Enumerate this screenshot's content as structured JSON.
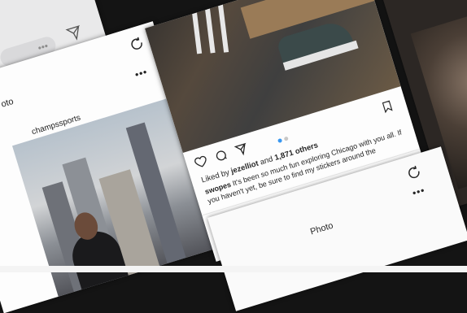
{
  "center_post": {
    "liked_prefix": "Liked by",
    "liked_user": "jezelliot",
    "liked_mid": "and",
    "liked_count": "1,871 others",
    "caption_user": "swopes",
    "caption_text": "It's been so much fun exploring Chicago with you all. If you haven't yet, be sure to find my stickers around the"
  },
  "left_post": {
    "title": "oto",
    "handle": "champssports"
  },
  "bottom_screen": {
    "title": "Photo"
  },
  "icons": {
    "like": "heart-icon",
    "comment": "comment-icon",
    "share": "send-icon",
    "save": "bookmark-icon",
    "home": "home-icon",
    "search": "search-icon",
    "add": "plus-square-icon",
    "activity": "heart-icon",
    "profile": "user-icon",
    "refresh": "refresh-icon",
    "more": "more-icon"
  },
  "colors": {
    "background": "#141414",
    "screen": "#fdfdfd",
    "text": "#262626",
    "pager_active": "#3897f0"
  }
}
